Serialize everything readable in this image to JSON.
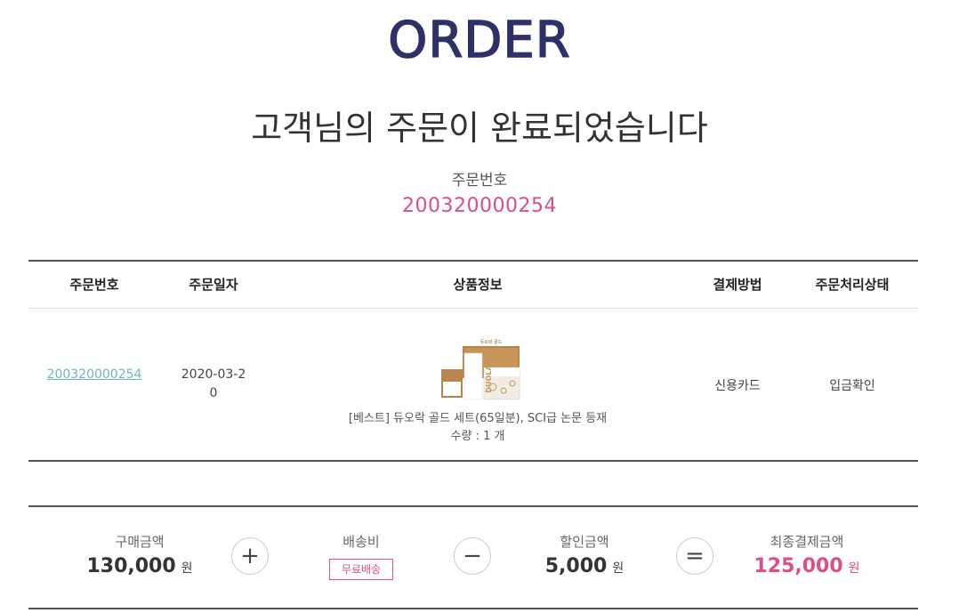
{
  "header": {
    "logo": "ORDER"
  },
  "completion": {
    "headline": "고객님의 주문이 완료되었습니다",
    "order_number_label": "주문번호",
    "order_number": "200320000254"
  },
  "order_table": {
    "headers": [
      "주문번호",
      "주문일자",
      "상품정보",
      "결제방법",
      "주문처리상태"
    ],
    "row": {
      "order_number": "200320000254",
      "order_date": "2020-03-20",
      "product_name": "[베스트] 듀오락 골드 세트(65일분), SCI급 논문 등재",
      "quantity_label": "수량 : ",
      "quantity": "1 개",
      "payment_method": "신용카드",
      "status": "입금확인",
      "product_image": {
        "box_text": "듀오락 골드",
        "side_text": "DUOLAC"
      }
    }
  },
  "summary": {
    "purchase_label": "구매금액",
    "purchase_amount": "130,000",
    "shipping_label": "배송비",
    "shipping_badge": "무료배송",
    "discount_label": "할인금액",
    "discount_amount": "5,000",
    "final_label": "최종결제금액",
    "final_amount": "125,000",
    "currency": "원",
    "operators": {
      "plus": "+",
      "minus": "−",
      "equals": "="
    }
  },
  "colors": {
    "brand": "#2e3168",
    "accent": "#d94f8a",
    "link": "#6fb3c2"
  }
}
